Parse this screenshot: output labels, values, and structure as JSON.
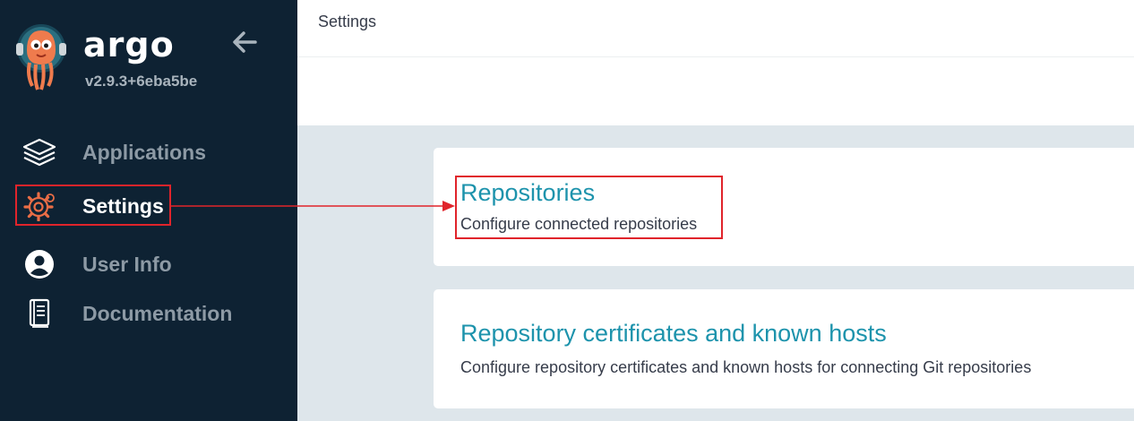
{
  "app": {
    "brand": "argo",
    "version": "v2.9.3+6eba5be"
  },
  "sidebar": {
    "items": [
      {
        "label": "Applications",
        "icon": "layers-icon"
      },
      {
        "label": "Settings",
        "icon": "gear-icon",
        "active": true
      },
      {
        "label": "User Info",
        "icon": "user-circle-icon"
      },
      {
        "label": "Documentation",
        "icon": "book-icon"
      }
    ]
  },
  "header": {
    "title": "Settings"
  },
  "cards": [
    {
      "title": "Repositories",
      "description": "Configure connected repositories"
    },
    {
      "title": "Repository certificates and known hosts",
      "description": "Configure repository certificates and known hosts for connecting Git repositories"
    }
  ],
  "colors": {
    "sidebar_bg": "#0e2233",
    "accent_link": "#1d93ac",
    "annotation_red": "#e0242b",
    "active_icon": "#e96d46"
  }
}
